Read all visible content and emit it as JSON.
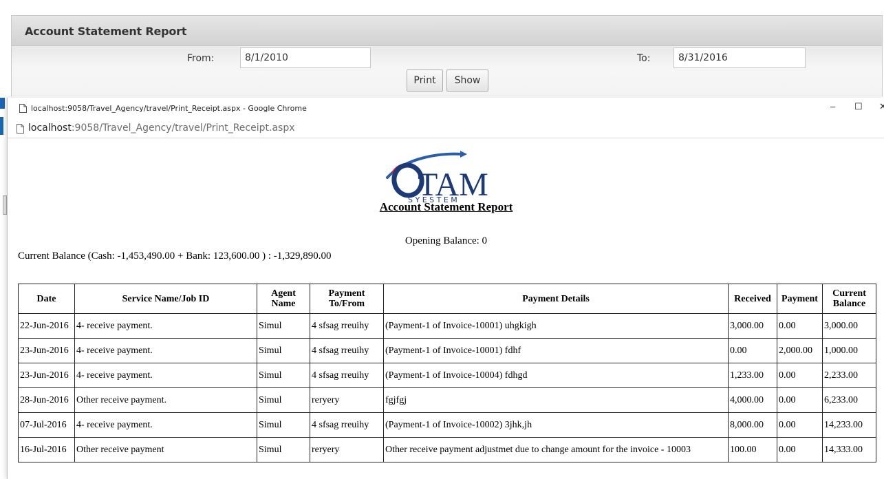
{
  "report_filter": {
    "title": "Account Statement Report",
    "from_label": "From:",
    "from_value": "8/1/2010",
    "to_label": "To:",
    "to_value": "8/31/2016",
    "print_label": "Print",
    "show_label": "Show"
  },
  "popup": {
    "window_title": "localhost:9058/Travel_Agency/travel/Print_Receipt.aspx - Google Chrome",
    "url_host": "localhost",
    "url_path": ":9058/Travel_Agency/travel/Print_Receipt.aspx",
    "minimize_glyph": "–",
    "maximize_glyph": "☐",
    "close_glyph": "✕"
  },
  "logo": {
    "main_text": "TAM",
    "sub_text": "S Y E S T E M",
    "colors": {
      "navy": "#1d3a78",
      "red": "#d0202a",
      "blue": "#2b5ea8"
    }
  },
  "report": {
    "title": "Account Statement Report",
    "opening_balance": "Opening Balance: 0",
    "current_balance": "Current Balance (Cash: -1,453,490.00  + Bank: 123,600.00 ) : -1,329,890.00",
    "columns": {
      "date": "Date",
      "service": "Service Name/Job ID",
      "agent": "Agent Name",
      "payment_to_from": "Payment To/From",
      "payment_details": "Payment Details",
      "received": "Received",
      "payment": "Payment",
      "current_balance": "Current Balance"
    },
    "rows": [
      {
        "date": "22-Jun-2016",
        "service": "4- receive payment.",
        "agent": "Simul",
        "to_from": "4 sfsag rreuihy",
        "details": "(Payment-1 of Invoice-10001) uhgkigh",
        "received": "3,000.00",
        "payment": "0.00",
        "balance": "3,000.00"
      },
      {
        "date": "23-Jun-2016",
        "service": "4- receive payment.",
        "agent": "Simul",
        "to_from": "4 sfsag rreuihy",
        "details": "(Payment-1 of Invoice-10001) fdhf",
        "received": "0.00",
        "payment": "2,000.00",
        "balance": "1,000.00"
      },
      {
        "date": "23-Jun-2016",
        "service": "4- receive payment.",
        "agent": "Simul",
        "to_from": "4 sfsag rreuihy",
        "details": "(Payment-1 of Invoice-10004) fdhgd",
        "received": "1,233.00",
        "payment": "0.00",
        "balance": "2,233.00"
      },
      {
        "date": "28-Jun-2016",
        "service": "Other receive payment.",
        "agent": "Simul",
        "to_from": "reryery",
        "details": "fgjfgj",
        "received": "4,000.00",
        "payment": "0.00",
        "balance": "6,233.00"
      },
      {
        "date": "07-Jul-2016",
        "service": "4- receive payment.",
        "agent": "Simul",
        "to_from": "4 sfsag rreuihy",
        "details": "(Payment-1 of Invoice-10002) 3jhk,jh",
        "received": "8,000.00",
        "payment": "0.00",
        "balance": "14,233.00"
      },
      {
        "date": "16-Jul-2016",
        "service": "Other receive payment",
        "agent": "Simul",
        "to_from": "reryery",
        "details": "Other receive payment adjustmet due to change amount for the invoice - 10003",
        "received": "100.00",
        "payment": "0.00",
        "balance": "14,333.00"
      }
    ]
  }
}
